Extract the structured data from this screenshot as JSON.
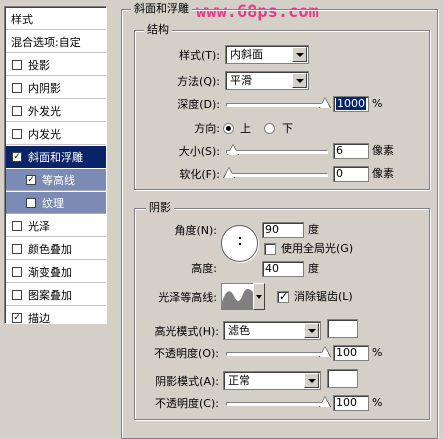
{
  "watermark": "www.68ps.com",
  "sidebar": {
    "items": [
      {
        "label": "样式",
        "checked": null
      },
      {
        "label": "混合选项:自定",
        "checked": null
      },
      {
        "label": "投影",
        "checked": false
      },
      {
        "label": "内阴影",
        "checked": false
      },
      {
        "label": "外发光",
        "checked": false
      },
      {
        "label": "内发光",
        "checked": false
      },
      {
        "label": "斜面和浮雕",
        "checked": true
      },
      {
        "label": "等高线",
        "checked": true
      },
      {
        "label": "纹理",
        "checked": false
      },
      {
        "label": "光泽",
        "checked": false
      },
      {
        "label": "颜色叠加",
        "checked": false
      },
      {
        "label": "渐变叠加",
        "checked": false
      },
      {
        "label": "图案叠加",
        "checked": false
      },
      {
        "label": "描边",
        "checked": true
      }
    ]
  },
  "bevel": {
    "title": "斜面和浮雕",
    "structure": {
      "title": "结构",
      "style_label": "样式(T):",
      "style_value": "内斜面",
      "technique_label": "方法(Q):",
      "technique_value": "平滑",
      "depth_label": "深度(D):",
      "depth_value": "1000",
      "depth_unit": "%",
      "depth_slider": 1.0,
      "direction_label": "方向:",
      "direction_up": "上",
      "direction_down": "下",
      "size_label": "大小(S):",
      "size_value": "6",
      "size_unit": "像素",
      "size_slider": 0.04,
      "soften_label": "软化(F):",
      "soften_value": "0",
      "soften_unit": "像素",
      "soften_slider": 0.0
    },
    "shading": {
      "title": "阴影",
      "angle_label": "角度(N):",
      "angle_value": "90",
      "angle_unit": "度",
      "global_light_label": "使用全局光(G)",
      "altitude_label": "高度:",
      "altitude_value": "40",
      "altitude_unit": "度",
      "gloss_label": "光泽等高线:",
      "antialias_label": "消除锯齿(L)",
      "highlight_mode_label": "高光模式(H):",
      "highlight_mode_value": "滤色",
      "highlight_color": "#ffffff",
      "highlight_opacity_label": "不透明度(O):",
      "highlight_opacity_value": "100",
      "highlight_opacity_unit": "%",
      "highlight_opacity_slider": 1.0,
      "shadow_mode_label": "阴影模式(A):",
      "shadow_mode_value": "正常",
      "shadow_color": "#ffffff",
      "shadow_opacity_label": "不透明度(C):",
      "shadow_opacity_value": "100",
      "shadow_opacity_unit": "%",
      "shadow_opacity_slider": 1.0
    }
  }
}
